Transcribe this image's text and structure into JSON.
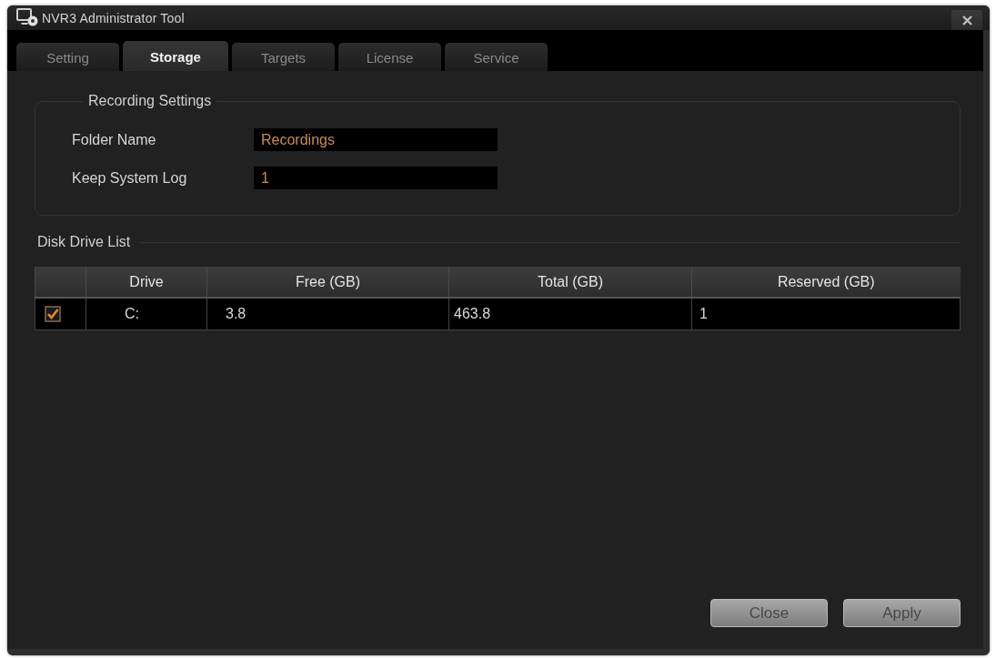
{
  "window": {
    "title": "NVR3 Administrator Tool"
  },
  "tabs": [
    {
      "label": "Setting",
      "selected": false
    },
    {
      "label": "Storage",
      "selected": true
    },
    {
      "label": "Targets",
      "selected": false
    },
    {
      "label": "License",
      "selected": false
    },
    {
      "label": "Service",
      "selected": false
    }
  ],
  "recording_settings": {
    "title": "Recording Settings",
    "fields": [
      {
        "label": "Folder Name",
        "value": "Recordings"
      },
      {
        "label": "Keep System Log",
        "value": "1"
      }
    ]
  },
  "disk_drive_list": {
    "title": "Disk Drive List",
    "columns": [
      "Drive",
      "Free (GB)",
      "Total (GB)",
      "Reserved (GB)"
    ],
    "rows": [
      {
        "checked": true,
        "cells": [
          "C:",
          "3.8",
          "463.8",
          "1"
        ]
      }
    ]
  },
  "buttons": [
    "Close",
    "Apply"
  ]
}
